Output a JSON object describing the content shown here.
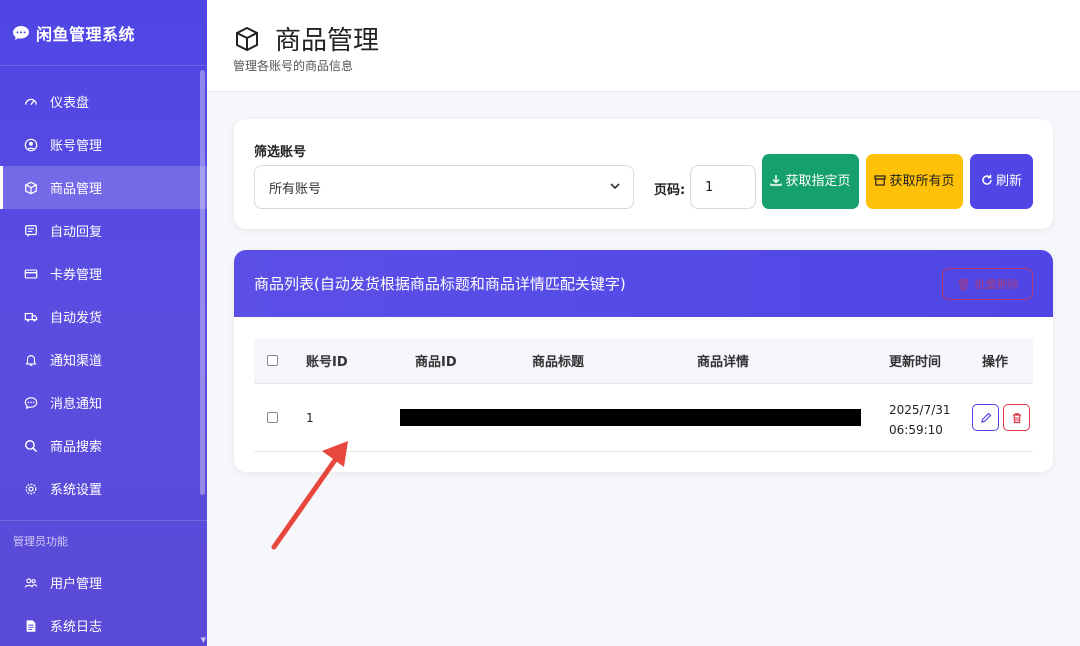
{
  "app": {
    "brand": "闲鱼管理系统"
  },
  "sidebar": {
    "items": [
      {
        "label": "仪表盘",
        "icon": "dashboard-icon"
      },
      {
        "label": "账号管理",
        "icon": "user-circle-icon"
      },
      {
        "label": "商品管理",
        "icon": "box-icon",
        "active": true
      },
      {
        "label": "自动回复",
        "icon": "chat-square-icon"
      },
      {
        "label": "卡券管理",
        "icon": "card-icon"
      },
      {
        "label": "自动发货",
        "icon": "truck-icon"
      },
      {
        "label": "通知渠道",
        "icon": "bell-icon"
      },
      {
        "label": "消息通知",
        "icon": "chat-dots-icon"
      },
      {
        "label": "商品搜索",
        "icon": "search-icon"
      },
      {
        "label": "系统设置",
        "icon": "gear-icon"
      }
    ],
    "admin_section": "管理员功能",
    "admin_items": [
      {
        "label": "用户管理",
        "icon": "people-icon"
      },
      {
        "label": "系统日志",
        "icon": "file-icon"
      }
    ]
  },
  "header": {
    "title": "商品管理",
    "subtitle": "管理各账号的商品信息"
  },
  "filter": {
    "label": "筛选账号",
    "select_value": "所有账号",
    "page_label": "页码:",
    "page_value": "1",
    "btn_fetch_page": "获取指定页",
    "btn_fetch_all": "获取所有页",
    "btn_refresh": "刷新"
  },
  "list": {
    "title": "商品列表(自动发货根据商品标题和商品详情匹配关键字)",
    "batch_delete": "批量删除",
    "columns": [
      "账号ID",
      "商品ID",
      "商品标题",
      "商品详情",
      "更新时间",
      "操作"
    ],
    "rows": [
      {
        "account_id": "1",
        "updated_date": "2025/7/31",
        "updated_time": "06:59:10"
      }
    ]
  },
  "colors": {
    "primary": "#4f46e5",
    "success": "#16a06b",
    "warning": "#ffc107",
    "danger": "#dc3545",
    "annotation_arrow": "#e8473d"
  }
}
